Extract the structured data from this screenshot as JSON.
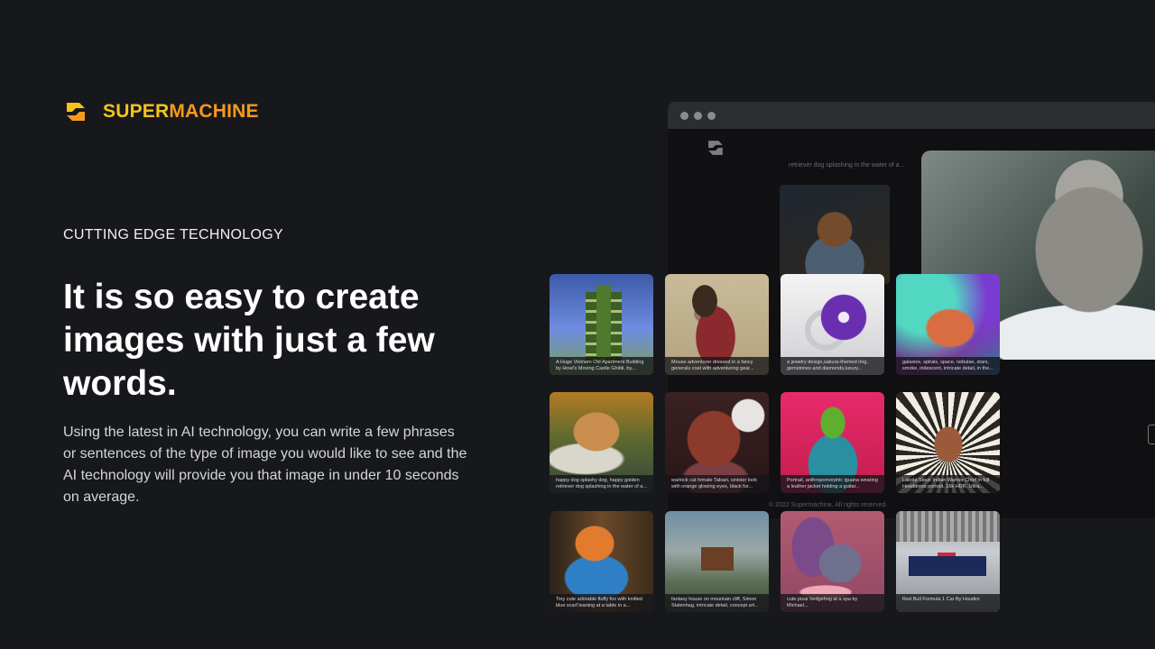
{
  "brand": {
    "name_part1": "SUPER",
    "name_part2": "MACHINE",
    "colors": {
      "yellow": "#f6c31c",
      "orange": "#f79a1a"
    },
    "logo_icon": "supermachine-logo"
  },
  "hero": {
    "eyebrow": "CUTTING EDGE TECHNOLOGY",
    "headline": "It is so easy to create images with just a few words.",
    "description": "Using the latest in AI technology, you can write a few phrases or sentences of the type of image you would like to see and the AI technology will provide you that image in under 10 seconds on average."
  },
  "browser_mockup": {
    "top_caption": "retriever dog splashing in the water of a...",
    "footer": "© 2022 Supermachine. All rights reserved."
  },
  "gallery": [
    {
      "caption": "A Huge Vietnam Old Apartment Building by Howl's Moving Castle Ghibli, by..."
    },
    {
      "caption": "Mouse adventurer dressed in a fancy generals coat with adventuring gear..."
    },
    {
      "caption": "a jewelry design,sakura-themed ring, gemstones and diamonds,luxury..."
    },
    {
      "caption": "galaxies, spirals, space, nebulae, stars, smoke, iridescent, intricate detail, in the..."
    },
    {
      "caption": "happy dog splashy dog, happy golden retriever dog splashing in the water of a..."
    },
    {
      "caption": "warlock cat female Tabaxi, sinister look with orange glowing eyes, black fur..."
    },
    {
      "caption": "Portrait, anthropomorphic iguana wearing a leather jacket holding a guitar..."
    },
    {
      "caption": "Lakota Sioux Indian Warrior Chief in full Headdress portrait, 16k HDR, Ultra..."
    },
    {
      "caption": "Tiny cute adorable fluffy fox with knitted blue scarf leaning at a table in a..."
    },
    {
      "caption": "fantasy house on mountain cliff, Simon Stalenhag, intricate detail, concept art..."
    },
    {
      "caption": "cute pixar hedgehog at a spa by Michael..."
    },
    {
      "caption": "Red Bull Formula 1 Car By Houdini"
    }
  ]
}
